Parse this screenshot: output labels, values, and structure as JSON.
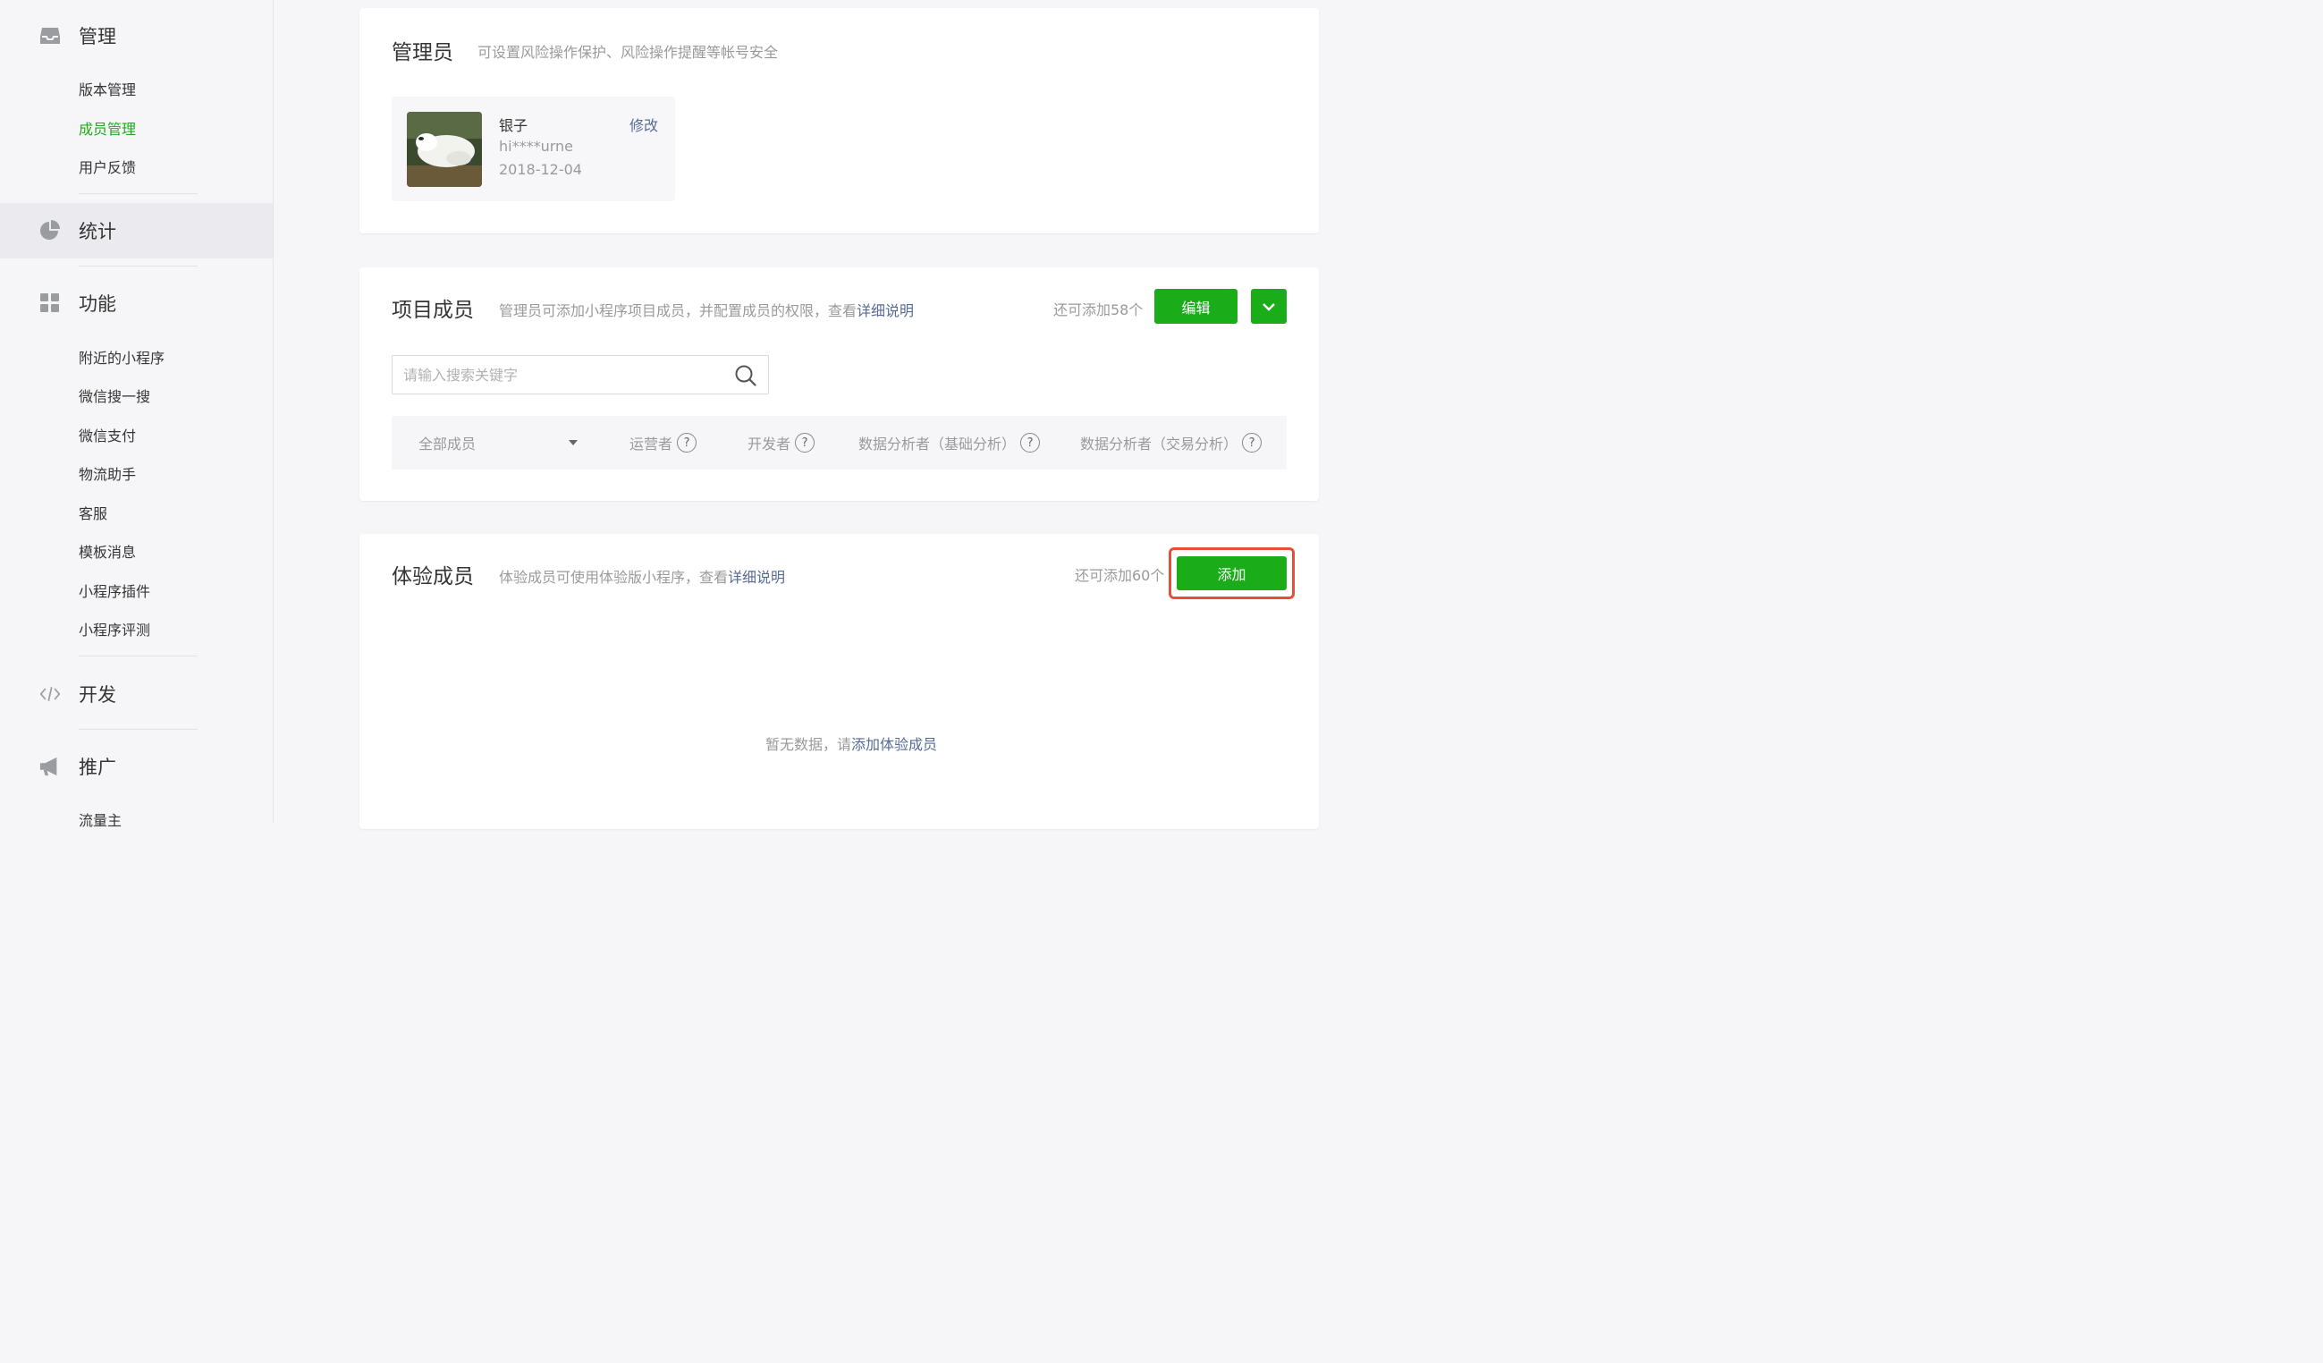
{
  "sidebar": {
    "groups": [
      {
        "label": "管理",
        "icon": "inbox-icon",
        "items": [
          "版本管理",
          "成员管理",
          "用户反馈"
        ],
        "active_item": "成员管理"
      },
      {
        "label": "统计",
        "icon": "pie-chart-icon",
        "items": []
      },
      {
        "label": "功能",
        "icon": "grid-icon",
        "items": [
          "附近的小程序",
          "微信搜一搜",
          "微信支付",
          "物流助手",
          "客服",
          "模板消息",
          "小程序插件",
          "小程序评测"
        ]
      },
      {
        "label": "开发",
        "icon": "code-icon",
        "items": []
      },
      {
        "label": "推广",
        "icon": "megaphone-icon",
        "items": [
          "流量主"
        ]
      }
    ]
  },
  "admin_card": {
    "title": "管理员",
    "desc": "可设置风险操作保护、风险操作提醒等帐号安全",
    "admin": {
      "name": "银子",
      "id": "hi****urne",
      "date": "2018-12-04",
      "edit_label": "修改"
    }
  },
  "project_card": {
    "title": "项目成员",
    "desc_prefix": "管理员可添加小程序项目成员，并配置成员的权限，查看",
    "desc_link": "详细说明",
    "remain": "还可添加58个",
    "edit_label": "编辑",
    "search_placeholder": "请输入搜索关键字",
    "filter_all": "全部成员",
    "roles": [
      "运营者",
      "开发者",
      "数据分析者（基础分析）",
      "数据分析者（交易分析）"
    ]
  },
  "trial_card": {
    "title": "体验成员",
    "desc_prefix": "体验成员可使用体验版小程序，查看",
    "desc_link": "详细说明",
    "remain": "还可添加60个",
    "add_label": "添加",
    "empty_prefix": "暂无数据，请",
    "empty_link": "添加体验成员"
  },
  "colors": {
    "accent": "#1aad19",
    "link": "#576b95",
    "highlight": "#e64e38"
  }
}
